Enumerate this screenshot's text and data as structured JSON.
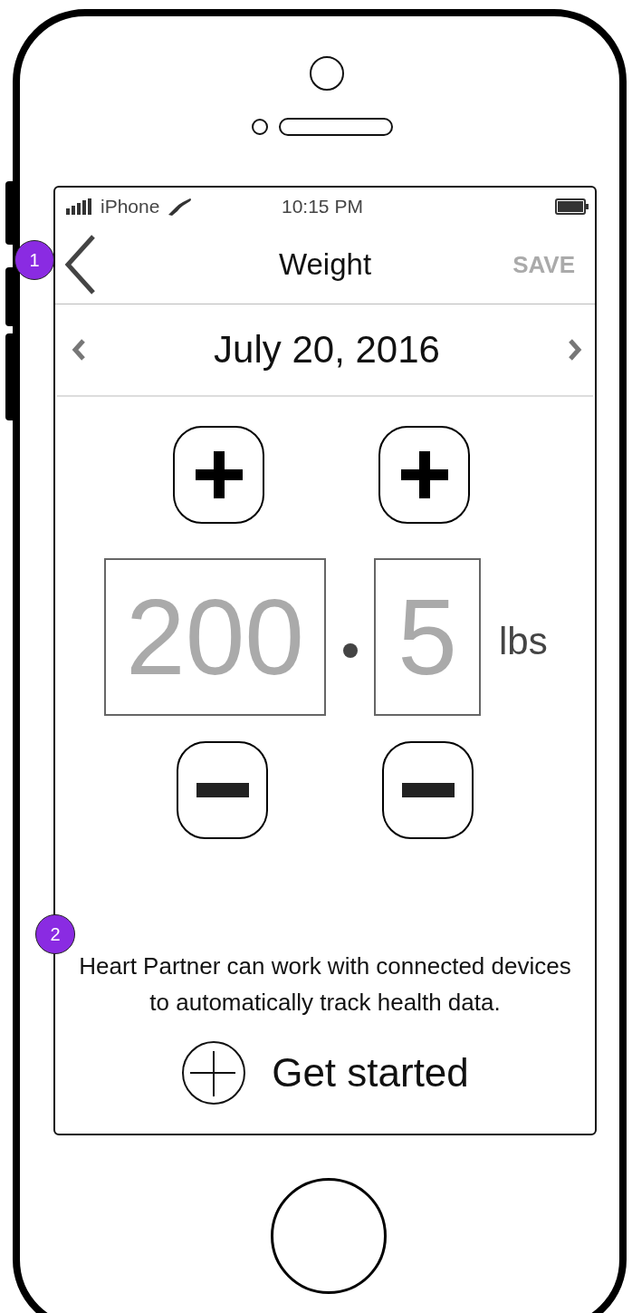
{
  "status_bar": {
    "carrier": "iPhone",
    "time": "10:15 PM"
  },
  "nav": {
    "badge": "1",
    "title": "Weight",
    "action": "SAVE"
  },
  "date_nav": {
    "date": "July 20, 2016"
  },
  "weight": {
    "whole": "200",
    "decimal": "5",
    "unit": "lbs"
  },
  "devices": {
    "badge": "2",
    "message": "Heart Partner can work with connected devices to automatically track health data.",
    "action": "Get started"
  }
}
